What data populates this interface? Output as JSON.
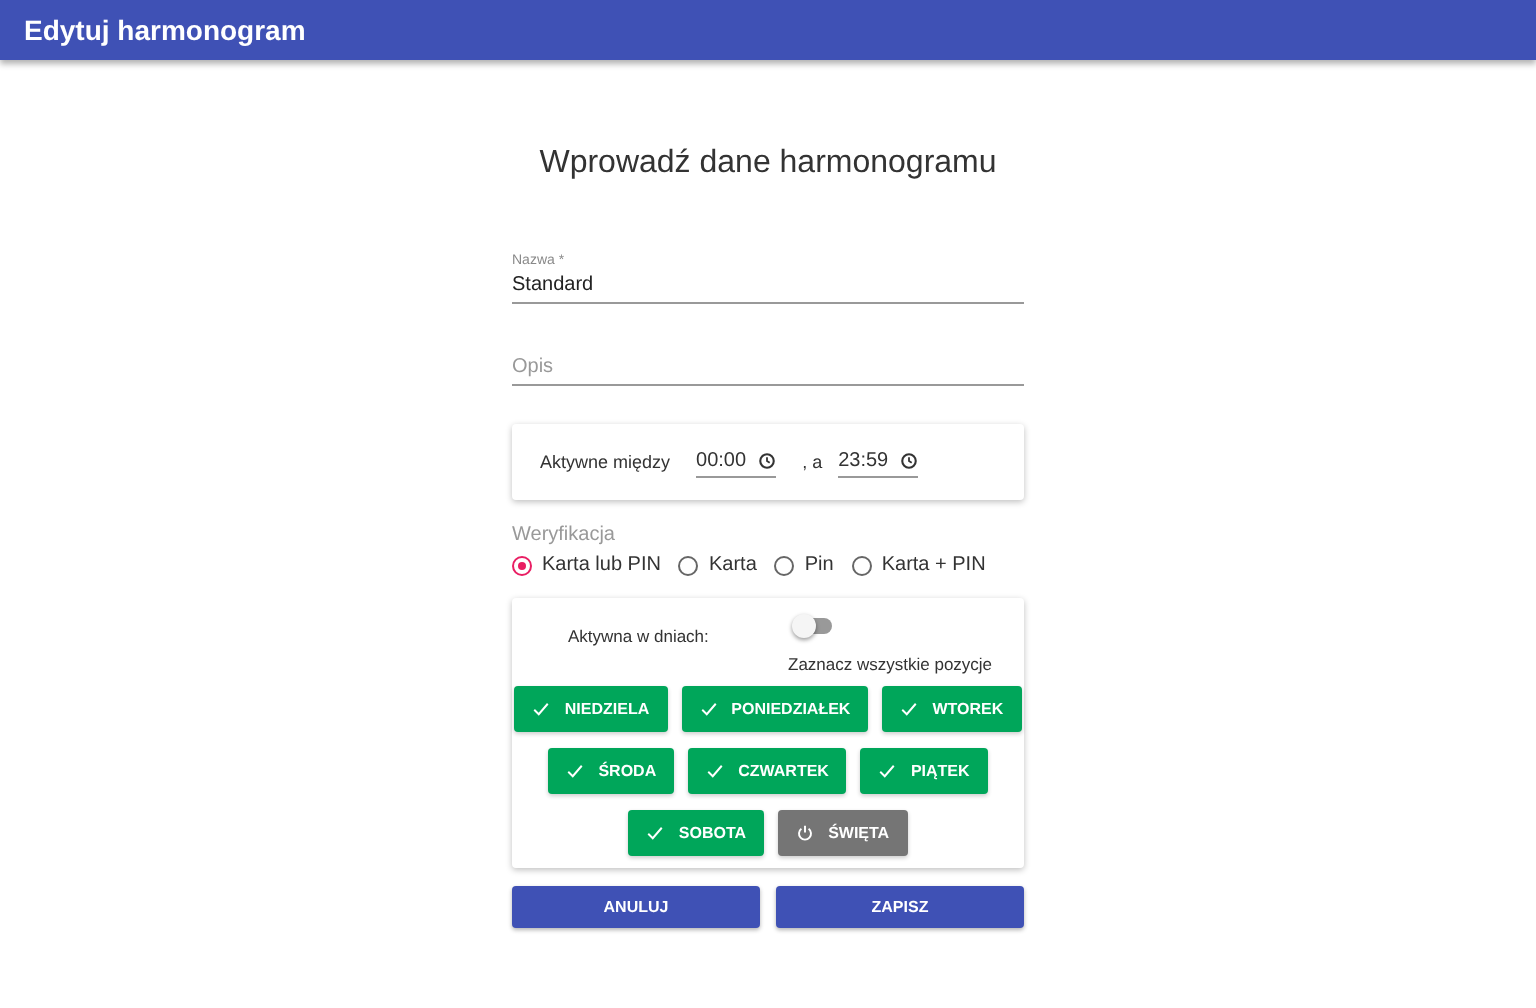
{
  "app_bar": {
    "title": "Edytuj harmonogram"
  },
  "heading": "Wprowadź dane harmonogramu",
  "name_field": {
    "label": "Nazwa *",
    "value": "Standard"
  },
  "description_field": {
    "placeholder": "Opis"
  },
  "active_hours": {
    "label": "Aktywne między",
    "from": "00:00",
    "separator": ", a",
    "to": "23:59"
  },
  "verification": {
    "label": "Weryfikacja",
    "options": [
      {
        "label": "Karta lub PIN",
        "selected": true
      },
      {
        "label": "Karta",
        "selected": false
      },
      {
        "label": "Pin",
        "selected": false
      },
      {
        "label": "Karta + PIN",
        "selected": false
      }
    ]
  },
  "days": {
    "label": "Aktywna w dniach:",
    "select_all": {
      "label": "Zaznacz wszystkie pozycje",
      "on": false
    },
    "rows": [
      [
        {
          "label": "NIEDZIELA",
          "selected": true
        },
        {
          "label": "PONIEDZIAŁEK",
          "selected": true
        },
        {
          "label": "WTOREK",
          "selected": true
        }
      ],
      [
        {
          "label": "ŚRODA",
          "selected": true
        },
        {
          "label": "CZWARTEK",
          "selected": true
        },
        {
          "label": "PIĄTEK",
          "selected": true
        }
      ],
      [
        {
          "label": "SOBOTA",
          "selected": true
        },
        {
          "label": "ŚWIĘTA",
          "selected": false
        }
      ]
    ]
  },
  "buttons": [
    {
      "label": "ANULUJ"
    },
    {
      "label": "ZAPISZ"
    }
  ]
}
